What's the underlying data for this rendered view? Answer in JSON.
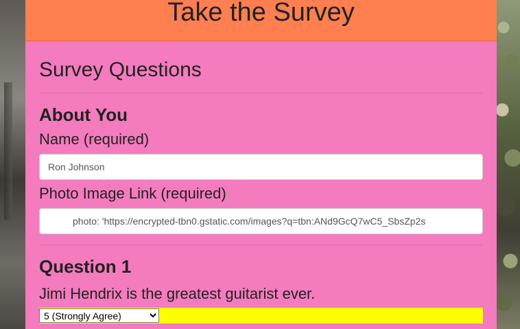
{
  "header": {
    "title": "Take the Survey"
  },
  "survey": {
    "section_title": "Survey Questions",
    "about": {
      "heading": "About You",
      "name_label": "Name (required)",
      "name_value": "Ron Johnson",
      "photo_label": "Photo Image Link (required)",
      "photo_value": "photo: 'https://encrypted-tbn0.gstatic.com/images?q=tbn:ANd9GcQ7wC5_SbsZp2s"
    },
    "question1": {
      "heading": "Question 1",
      "text": "Jimi Hendrix is the greatest guitarist ever.",
      "selected": "5 (Strongly Agree)"
    }
  },
  "colors": {
    "header_bg": "#ff7f50",
    "body_bg": "#f37bbe",
    "select_highlight": "#ffff00"
  }
}
